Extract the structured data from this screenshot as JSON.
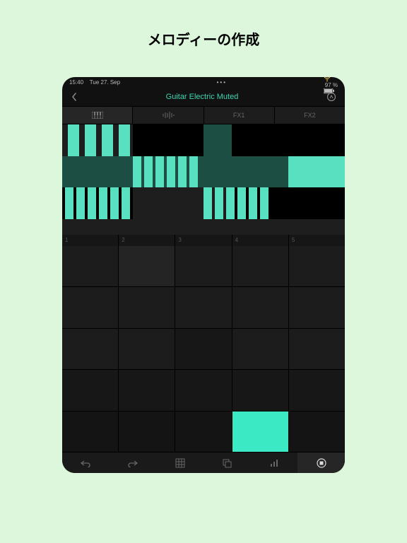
{
  "page": {
    "title": "メロディーの作成"
  },
  "statusbar": {
    "time": "15:40",
    "date": "Tue 27. Sep",
    "battery": "97 %"
  },
  "navbar": {
    "title": "Guitar Electric Muted"
  },
  "tabs": {
    "t1_icon": "keyboard-icon",
    "t2_icon": "waveform-icon",
    "t3": "FX1",
    "t4": "FX2"
  },
  "columns": {
    "c1": "1",
    "c2": "2",
    "c3": "3",
    "c4": "4",
    "c5": "5"
  },
  "toolbar": {
    "undo": "undo-icon",
    "redo": "redo-icon",
    "grid": "grid-icon",
    "copy": "copy-icon",
    "bars": "bars-icon",
    "stop": "stop-icon"
  }
}
